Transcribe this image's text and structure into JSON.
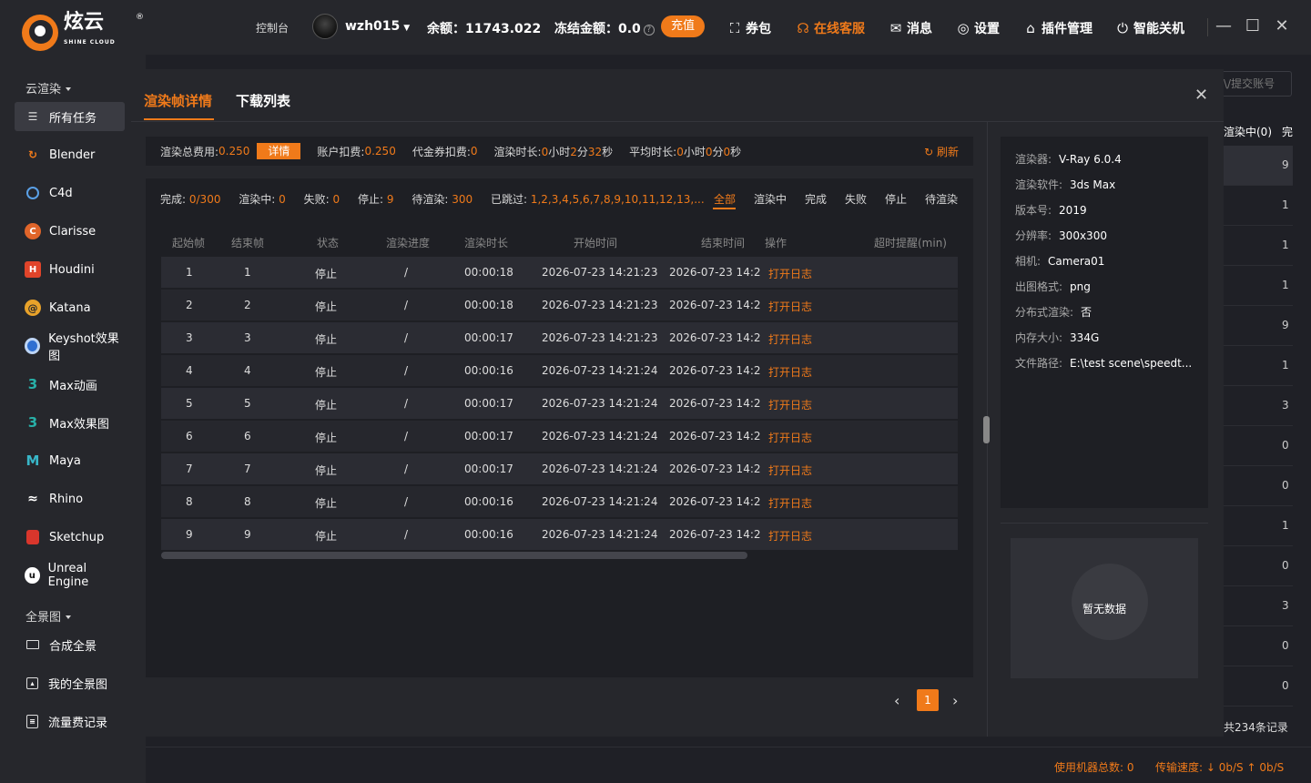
{
  "brand": {
    "name": "炫云",
    "sub": "SHINE CLOUD",
    "reg": "®"
  },
  "topbar": {
    "console": "控制台",
    "username": "wzh015",
    "balance": "余额：11743.022",
    "frozen": "冻结金额：0.0",
    "recharge": "充值",
    "coupon": "券包",
    "service": "在线客服",
    "message": "消息",
    "settings": "设置",
    "plugins": "插件管理",
    "shutdown": "智能关机"
  },
  "sidebar": {
    "group_cloud": "云渲染",
    "all_tasks": "所有任务",
    "items": [
      "Blender",
      "C4d",
      "Clarisse",
      "Houdini",
      "Katana",
      "Keyshot效果图",
      "Max动画",
      "Max效果图",
      "Maya",
      "Rhino",
      "Sketchup",
      "Unreal Engine"
    ],
    "group_pano": "全景图",
    "compose_pano": "合成全景",
    "my_pano": "我的全景图",
    "traffic": "流量费记录"
  },
  "background": {
    "search_placeholder": "\\/提交账号",
    "col_rendering": "渲染中(0)",
    "col_done": "完",
    "rows": [
      "9",
      "1",
      "1",
      "1",
      "9",
      "1",
      "3",
      "0",
      "0",
      "1",
      "0",
      "3",
      "0",
      "0"
    ],
    "total": "共234条记录",
    "machines_label": "使用机器总数:",
    "machines": "0",
    "speed_label": "传输速度:",
    "down": "↓ 0b/S",
    "up": "↑ 0b/S"
  },
  "modal": {
    "tab_frames": "渲染帧详情",
    "tab_downloads": "下载列表",
    "summary": {
      "total_fee_label": "渲染总费用:",
      "total_fee": "0.250",
      "detail": "详情",
      "account_label": "账户扣费:",
      "account": "0.250",
      "voucher_label": "代金券扣费:",
      "voucher": "0",
      "duration_label": "渲染时长:",
      "duration_h": "0",
      "duration_m": "2",
      "duration_s": "32",
      "avg_label": "平均时长:",
      "avg_h": "0",
      "avg_m": "0",
      "avg_s": "0",
      "refresh": "刷新"
    },
    "filters": {
      "done_label": "完成:",
      "done": "0/300",
      "rendering_label": "渲染中:",
      "rendering": "0",
      "failed_label": "失败:",
      "failed": "0",
      "stopped_label": "停止:",
      "stopped": "9",
      "waiting_label": "待渲染:",
      "waiting": "300",
      "skipped_label": "已跳过:",
      "skipped": "1,2,3,4,5,6,7,8,9,10,11,12,13,...",
      "tabs": [
        "全部",
        "渲染中",
        "完成",
        "失败",
        "停止",
        "待渲染"
      ]
    },
    "columns": [
      "起始帧",
      "结束帧",
      "状态",
      "渲染进度",
      "渲染时长",
      "开始时间",
      "结束时间",
      "操作",
      "超时提醒(min)"
    ],
    "rows": [
      {
        "start": "1",
        "end": "1",
        "status": "停止",
        "progress": "/",
        "duration": "00:00:18",
        "begin": "2026-07-23 14:21:23",
        "finish": "2026-07-23 14:2",
        "action": "打开日志"
      },
      {
        "start": "2",
        "end": "2",
        "status": "停止",
        "progress": "/",
        "duration": "00:00:18",
        "begin": "2026-07-23 14:21:23",
        "finish": "2026-07-23 14:2",
        "action": "打开日志"
      },
      {
        "start": "3",
        "end": "3",
        "status": "停止",
        "progress": "/",
        "duration": "00:00:17",
        "begin": "2026-07-23 14:21:23",
        "finish": "2026-07-23 14:2",
        "action": "打开日志"
      },
      {
        "start": "4",
        "end": "4",
        "status": "停止",
        "progress": "/",
        "duration": "00:00:16",
        "begin": "2026-07-23 14:21:24",
        "finish": "2026-07-23 14:2",
        "action": "打开日志"
      },
      {
        "start": "5",
        "end": "5",
        "status": "停止",
        "progress": "/",
        "duration": "00:00:17",
        "begin": "2026-07-23 14:21:24",
        "finish": "2026-07-23 14:2",
        "action": "打开日志"
      },
      {
        "start": "6",
        "end": "6",
        "status": "停止",
        "progress": "/",
        "duration": "00:00:17",
        "begin": "2026-07-23 14:21:24",
        "finish": "2026-07-23 14:2",
        "action": "打开日志"
      },
      {
        "start": "7",
        "end": "7",
        "status": "停止",
        "progress": "/",
        "duration": "00:00:17",
        "begin": "2026-07-23 14:21:24",
        "finish": "2026-07-23 14:2",
        "action": "打开日志"
      },
      {
        "start": "8",
        "end": "8",
        "status": "停止",
        "progress": "/",
        "duration": "00:00:16",
        "begin": "2026-07-23 14:21:24",
        "finish": "2026-07-23 14:2",
        "action": "打开日志"
      },
      {
        "start": "9",
        "end": "9",
        "status": "停止",
        "progress": "/",
        "duration": "00:00:16",
        "begin": "2026-07-23 14:21:24",
        "finish": "2026-07-23 14:2",
        "action": "打开日志"
      }
    ],
    "page": "1",
    "info": [
      {
        "k": "渲染器:",
        "v": "V-Ray 6.0.4"
      },
      {
        "k": "渲染软件:",
        "v": "3ds Max"
      },
      {
        "k": "版本号:",
        "v": "2019"
      },
      {
        "k": "分辨率:",
        "v": "300x300"
      },
      {
        "k": "相机:",
        "v": "Camera01"
      },
      {
        "k": "出图格式:",
        "v": "png"
      },
      {
        "k": "分布式渲染:",
        "v": "否"
      },
      {
        "k": "内存大小:",
        "v": "334G"
      },
      {
        "k": "文件路径:",
        "v": "E:\\test scene\\speedt..."
      }
    ],
    "no_data": "暂无数据"
  },
  "colors": {
    "accent": "#f07a1a",
    "bg": "#1f2026",
    "panel": "#26272c"
  }
}
